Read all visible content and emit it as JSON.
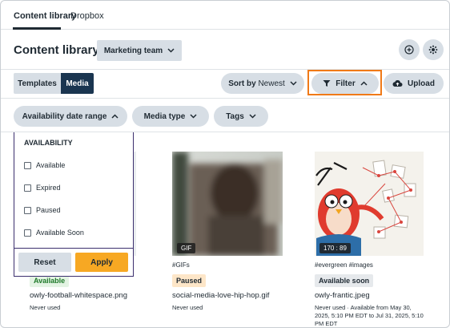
{
  "tabs": [
    {
      "label": "Content library",
      "active": true
    },
    {
      "label": "Dropbox",
      "active": false
    }
  ],
  "header": {
    "title": "Content library",
    "team_select": "Marketing team",
    "icons": [
      "plus-circle-icon",
      "gear-icon"
    ]
  },
  "toolbar": {
    "segments": [
      {
        "label": "Templates",
        "selected": false
      },
      {
        "label": "Media",
        "selected": true
      }
    ],
    "sort_label": "Sort by",
    "sort_value": "Newest",
    "filter_label": "Filter",
    "upload_label": "Upload"
  },
  "filters": {
    "availability": "Availability date range",
    "media_type": "Media type",
    "tags": "Tags"
  },
  "availability_dropdown": {
    "title": "AVAILABILITY",
    "options": [
      {
        "label": "Available",
        "checked": false
      },
      {
        "label": "Expired",
        "checked": false
      },
      {
        "label": "Paused",
        "checked": false
      },
      {
        "label": "Available Soon",
        "checked": false
      }
    ],
    "reset_label": "Reset",
    "apply_label": "Apply"
  },
  "cards": [
    {
      "tags": "",
      "status": "Available",
      "filename": "owly-football-whitespace.png",
      "usage": "Never used"
    },
    {
      "overlay": "GIF",
      "tags": "#GIFs",
      "status": "Paused",
      "filename": "social-media-love-hip-hop.gif",
      "usage": "Never used"
    },
    {
      "overlay": "170 : 89",
      "tags": "#evergreen  #images",
      "status": "Available soon",
      "filename": "owly-frantic.jpeg",
      "usage_lines": [
        "Never used · Available from May 30,",
        "2025, 5:10 PM EDT to Jul 31, 2025, 5:10",
        "PM EDT"
      ]
    }
  ],
  "colors": {
    "primary_dark": "#1a3550",
    "button_bg": "#d7dee5",
    "apply": "#f7a823",
    "highlight": "#f07a18",
    "dropdown_border": "#3c2f6e",
    "available_bg": "#e3f3e3",
    "available_text": "#1f7a2a",
    "paused_bg": "#fde6c8",
    "soon_bg": "#e6e9ec"
  }
}
